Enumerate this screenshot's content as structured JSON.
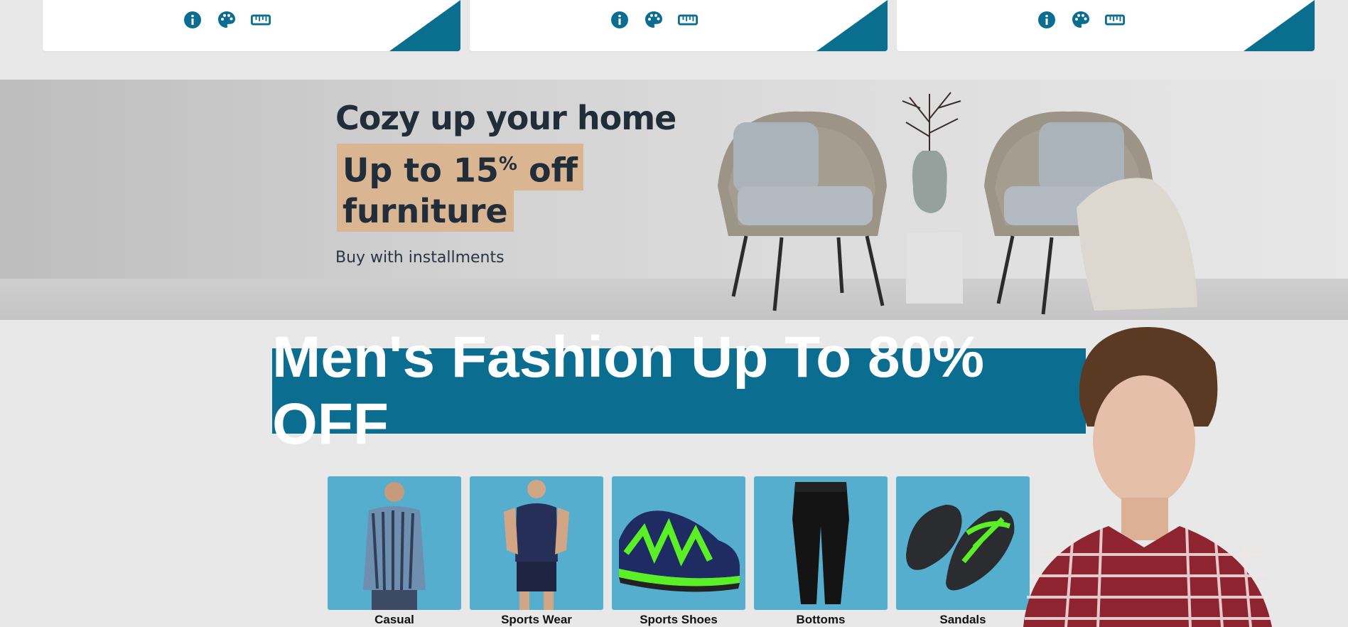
{
  "cards": [
    {
      "icons": [
        "info-icon",
        "palette-icon",
        "ruler-icon"
      ]
    },
    {
      "icons": [
        "info-icon",
        "palette-icon",
        "ruler-icon"
      ]
    },
    {
      "icons": [
        "info-icon",
        "palette-icon",
        "ruler-icon"
      ]
    }
  ],
  "banner": {
    "title": "Cozy up your home",
    "offer_line1_prefix": "Up to 15",
    "offer_line1_sup": "%",
    "offer_line1_suffix": " off",
    "offer_line2": "furniture",
    "subtitle": "Buy with installments"
  },
  "promo": {
    "text": "Men's Fashion Up To 80% OFF"
  },
  "categories": [
    {
      "label": "Casual"
    },
    {
      "label": "Sports Wear"
    },
    {
      "label": "Sports Shoes"
    },
    {
      "label": "Bottoms"
    },
    {
      "label": "Sandals"
    }
  ],
  "colors": {
    "accent": "#0b6e91",
    "tile": "#55aece",
    "offer_highlight": "#d9b592",
    "background": "#e8e8e8"
  }
}
